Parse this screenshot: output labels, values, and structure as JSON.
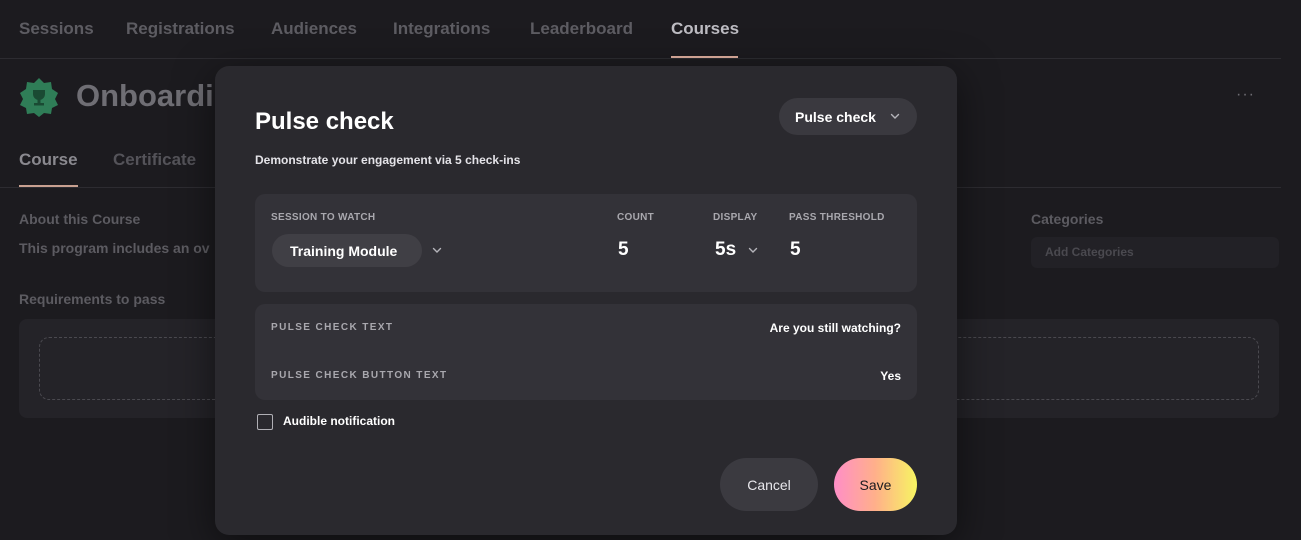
{
  "top_nav": {
    "tabs": [
      {
        "label": "Sessions"
      },
      {
        "label": "Registrations"
      },
      {
        "label": "Audiences"
      },
      {
        "label": "Integrations"
      },
      {
        "label": "Leaderboard"
      },
      {
        "label": "Courses"
      }
    ],
    "active": "Courses"
  },
  "course": {
    "title": "Onboardi",
    "badge_icon": "trophy-badge-icon",
    "more_icon": "more-horizontal-icon"
  },
  "sub_tabs": [
    {
      "label": "Course"
    },
    {
      "label": "Certificate"
    }
  ],
  "about": {
    "label": "About this Course",
    "text": "This program includes an ov"
  },
  "requirements": {
    "label": "Requirements to pass"
  },
  "categories": {
    "label": "Categories",
    "placeholder": "Add Categories"
  },
  "modal": {
    "title": "Pulse check",
    "subtitle": "Demonstrate your engagement via 5 check-ins",
    "type_select": "Pulse check",
    "settings": {
      "session_label": "SESSION TO WATCH",
      "session_value": "Training Module",
      "count_label": "COUNT",
      "count_value": "5",
      "display_label": "DISPLAY",
      "display_value": "5s",
      "threshold_label": "PASS THRESHOLD",
      "threshold_value": "5"
    },
    "text_fields": {
      "pulse_text_label": "PULSE CHECK TEXT",
      "pulse_text_value": "Are you still watching?",
      "button_text_label": "PULSE CHECK BUTTON TEXT",
      "button_text_value": "Yes"
    },
    "audible": {
      "label": "Audible notification",
      "checked": false
    },
    "cancel_label": "Cancel",
    "save_label": "Save"
  },
  "colors": {
    "background": "#1c1b1f",
    "modal": "#2a292e",
    "card": "#333238",
    "badge_green": "#2f7d57",
    "save_gradient": [
      "#ff8ec7",
      "#ffb08a",
      "#f7f562"
    ]
  }
}
